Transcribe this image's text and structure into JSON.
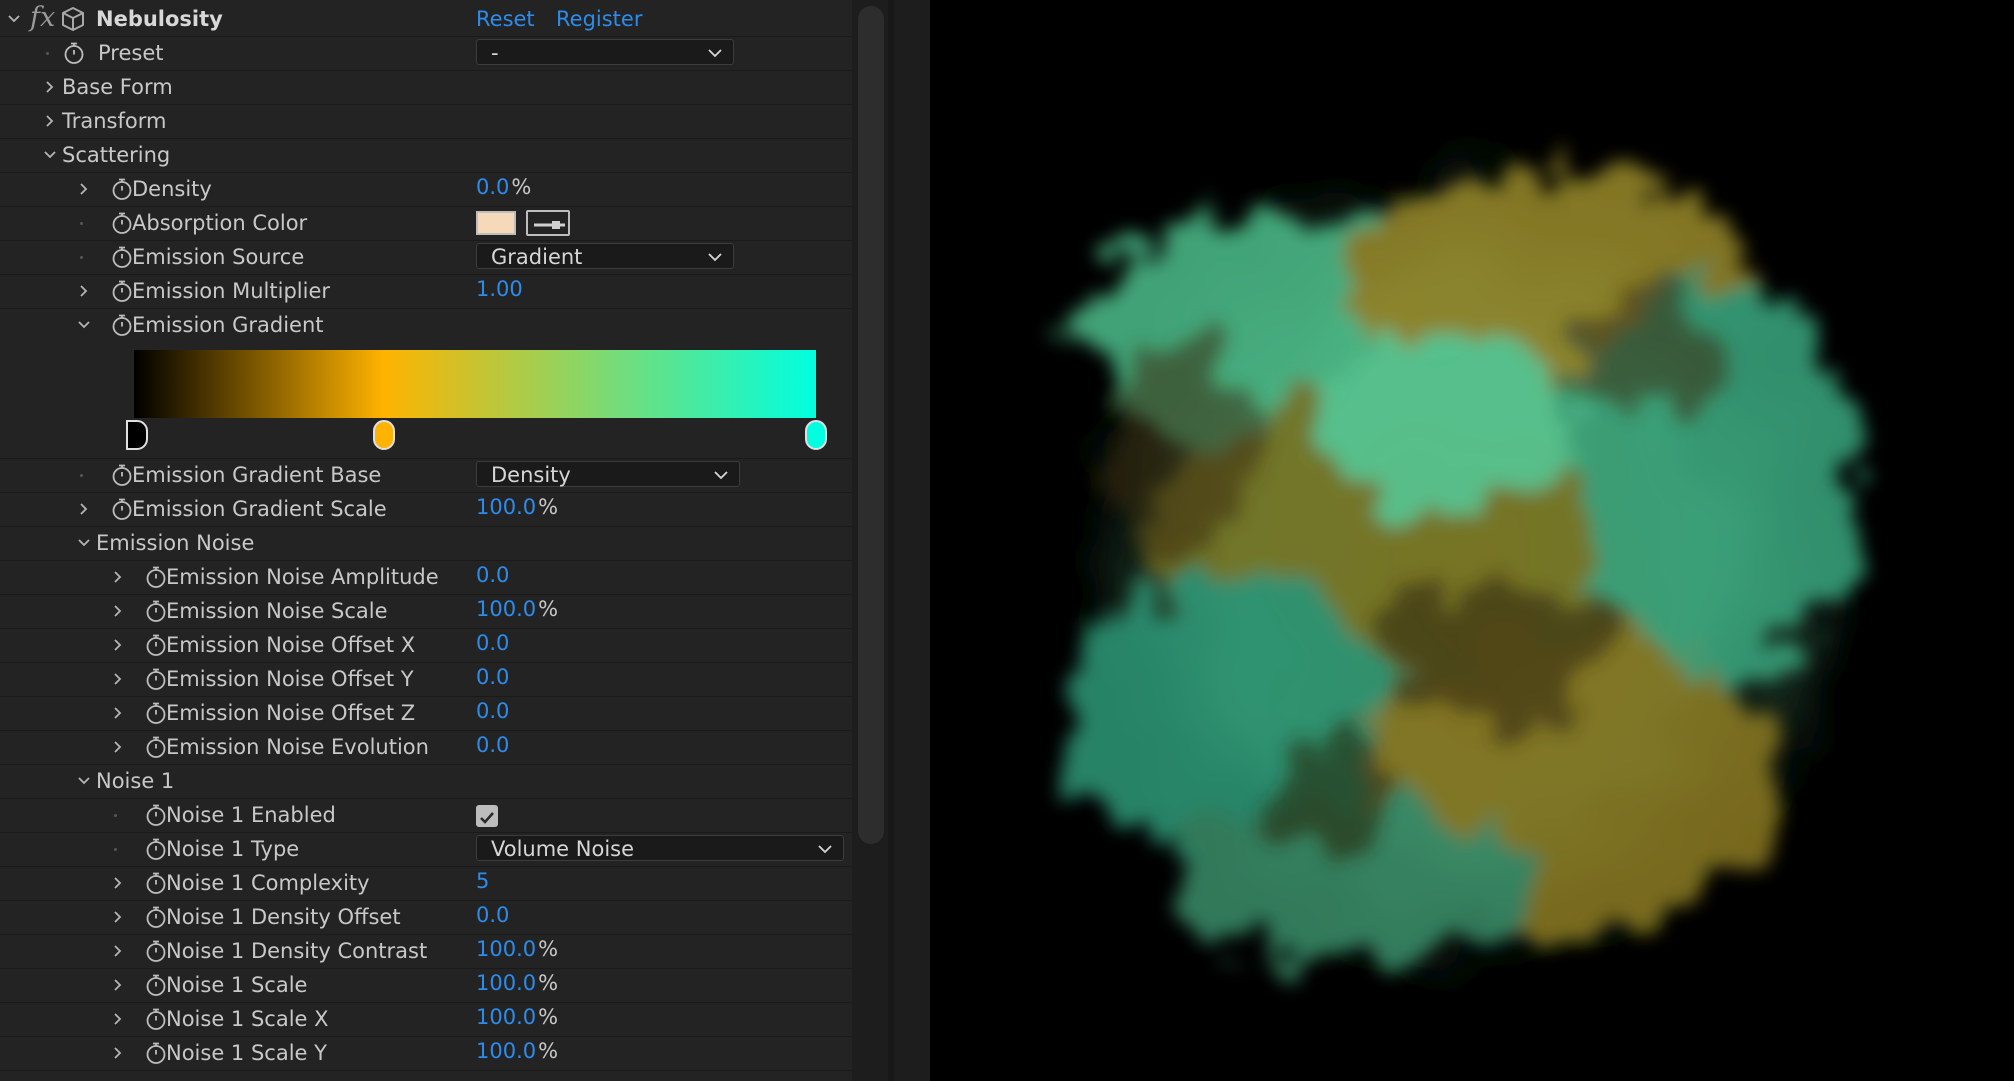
{
  "effect": {
    "name": "Nebulosity",
    "reset": "Reset",
    "register": "Register"
  },
  "rows": [
    {
      "id": "preset",
      "label": "Preset",
      "indent": 1,
      "twirl": "none",
      "stopwatch": true,
      "dot": true,
      "control": "dropdown",
      "value": "-",
      "ddLeft": 476,
      "ddWidth": 258
    },
    {
      "id": "baseform",
      "label": "Base Form",
      "indent": 1,
      "twirl": "closed",
      "stopwatch": false
    },
    {
      "id": "transform",
      "label": "Transform",
      "indent": 1,
      "twirl": "closed",
      "stopwatch": false
    },
    {
      "id": "scattering",
      "label": "Scattering",
      "indent": 1,
      "twirl": "open",
      "stopwatch": false
    },
    {
      "id": "density",
      "label": "Density",
      "indent": 2,
      "twirl": "closed",
      "stopwatch": true,
      "control": "value",
      "value": "0.0",
      "unit": "%"
    },
    {
      "id": "abscolor",
      "label": "Absorption Color",
      "indent": 2,
      "twirl": "none",
      "stopwatch": true,
      "dot": true,
      "control": "color",
      "value": "#f5d9b8"
    },
    {
      "id": "emsource",
      "label": "Emission Source",
      "indent": 2,
      "twirl": "none",
      "stopwatch": true,
      "dot": true,
      "control": "dropdown",
      "value": "Gradient",
      "ddLeft": 476,
      "ddWidth": 258
    },
    {
      "id": "emmult",
      "label": "Emission Multiplier",
      "indent": 2,
      "twirl": "closed",
      "stopwatch": true,
      "control": "value",
      "value": "1.00"
    },
    {
      "id": "emgrad",
      "label": "Emission Gradient",
      "indent": 2,
      "twirl": "open",
      "stopwatch": true,
      "control": "gradient"
    },
    {
      "id": "emgradbase",
      "label": "Emission Gradient Base",
      "indent": 2,
      "twirl": "none",
      "stopwatch": true,
      "dot": true,
      "control": "dropdown",
      "value": "Density",
      "ddLeft": 476,
      "ddWidth": 264
    },
    {
      "id": "emgradscale",
      "label": "Emission Gradient Scale",
      "indent": 2,
      "twirl": "closed",
      "stopwatch": true,
      "control": "value",
      "value": "100.0",
      "unit": "%"
    },
    {
      "id": "emnoise",
      "label": "Emission Noise",
      "indent": 2,
      "twirl": "open",
      "stopwatch": false
    },
    {
      "id": "enamp",
      "label": "Emission Noise Amplitude",
      "indent": 3,
      "twirl": "closed",
      "stopwatch": true,
      "control": "value",
      "value": "0.0"
    },
    {
      "id": "enscale",
      "label": "Emission Noise Scale",
      "indent": 3,
      "twirl": "closed",
      "stopwatch": true,
      "control": "value",
      "value": "100.0",
      "unit": "%"
    },
    {
      "id": "enox",
      "label": "Emission Noise Offset X",
      "indent": 3,
      "twirl": "closed",
      "stopwatch": true,
      "control": "value",
      "value": "0.0"
    },
    {
      "id": "enoy",
      "label": "Emission Noise Offset Y",
      "indent": 3,
      "twirl": "closed",
      "stopwatch": true,
      "control": "value",
      "value": "0.0"
    },
    {
      "id": "enoz",
      "label": "Emission Noise Offset Z",
      "indent": 3,
      "twirl": "closed",
      "stopwatch": true,
      "control": "value",
      "value": "0.0"
    },
    {
      "id": "enevo",
      "label": "Emission Noise Evolution",
      "indent": 3,
      "twirl": "closed",
      "stopwatch": true,
      "control": "value",
      "value": "0.0"
    },
    {
      "id": "noise1",
      "label": "Noise 1",
      "indent": 2,
      "twirl": "open",
      "stopwatch": false
    },
    {
      "id": "n1enabled",
      "label": "Noise 1 Enabled",
      "indent": 3,
      "twirl": "none",
      "stopwatch": true,
      "dot": true,
      "control": "checkbox",
      "value": "checked"
    },
    {
      "id": "n1type",
      "label": "Noise 1 Type",
      "indent": 3,
      "twirl": "none",
      "stopwatch": true,
      "dot": true,
      "control": "dropdown",
      "value": "Volume Noise",
      "ddLeft": 476,
      "ddWidth": 368
    },
    {
      "id": "n1complex",
      "label": "Noise 1 Complexity",
      "indent": 3,
      "twirl": "closed",
      "stopwatch": true,
      "control": "value",
      "value": "5"
    },
    {
      "id": "n1doff",
      "label": "Noise 1 Density Offset",
      "indent": 3,
      "twirl": "closed",
      "stopwatch": true,
      "control": "value",
      "value": "0.0"
    },
    {
      "id": "n1dcon",
      "label": "Noise 1 Density Contrast",
      "indent": 3,
      "twirl": "closed",
      "stopwatch": true,
      "control": "value",
      "value": "100.0",
      "unit": "%"
    },
    {
      "id": "n1scale",
      "label": "Noise 1 Scale",
      "indent": 3,
      "twirl": "closed",
      "stopwatch": true,
      "control": "value",
      "value": "100.0",
      "unit": "%"
    },
    {
      "id": "n1scalex",
      "label": "Noise 1 Scale X",
      "indent": 3,
      "twirl": "closed",
      "stopwatch": true,
      "control": "value",
      "value": "100.0",
      "unit": "%"
    },
    {
      "id": "n1scaley",
      "label": "Noise 1 Scale Y",
      "indent": 3,
      "twirl": "closed",
      "stopwatch": true,
      "control": "value",
      "value": "100.0",
      "unit": "%"
    }
  ],
  "gradient": {
    "stops": [
      {
        "color": "#000000",
        "pos": 0.0
      },
      {
        "color": "#ffb300",
        "pos": 0.366
      },
      {
        "color": "#00ffe0",
        "pos": 1.0
      }
    ]
  },
  "colors": {
    "accent": "#2d8ceb",
    "panel": "#232323",
    "text": "#c8c8c8"
  }
}
